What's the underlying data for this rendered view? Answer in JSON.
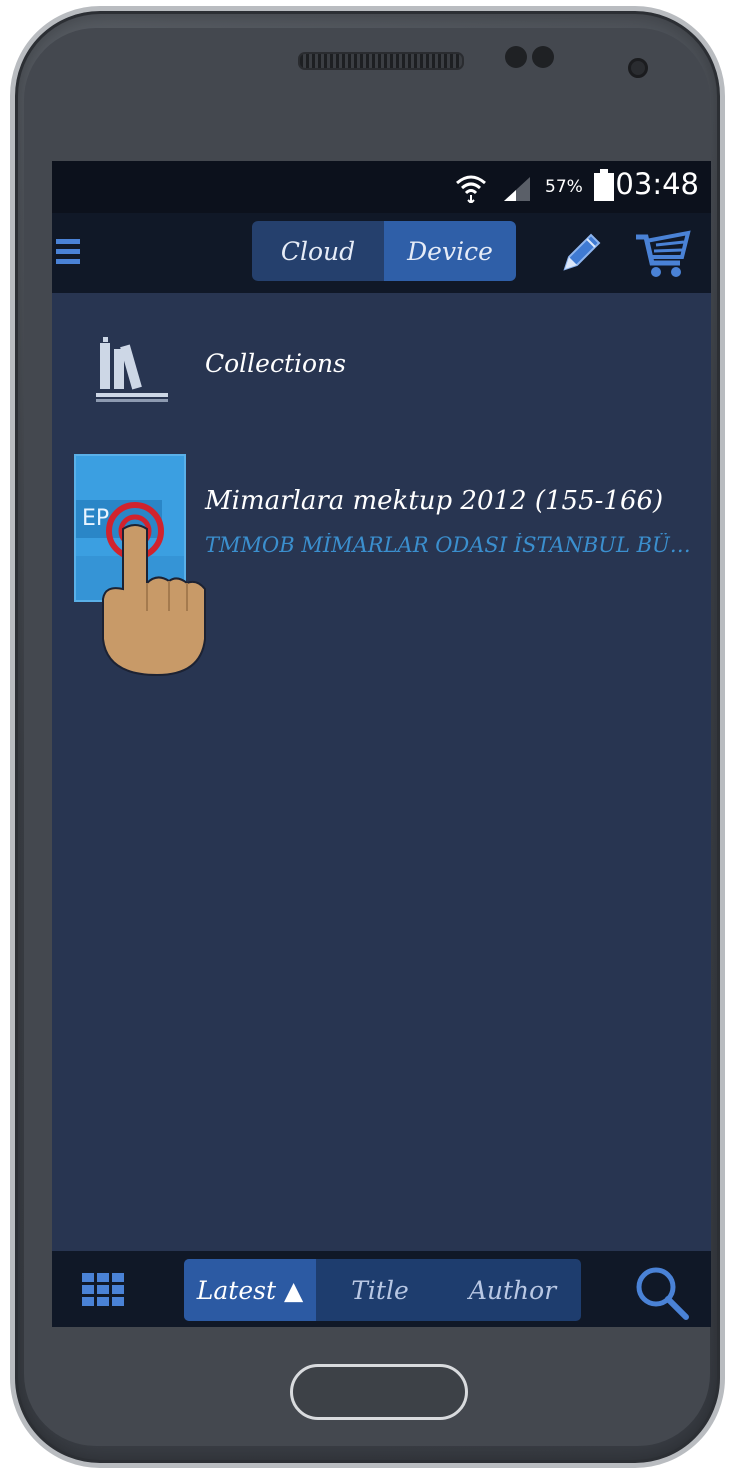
{
  "status_bar": {
    "battery_percent": "57%",
    "time": "03:48"
  },
  "top_bar": {
    "tabs": {
      "cloud": "Cloud",
      "device": "Device"
    },
    "active_tab": "Device"
  },
  "library": {
    "collections_label": "Collections",
    "book": {
      "cover_text": "EP",
      "title": "Mimarlara mektup 2012 (155-166)",
      "author": "TMMOB MİMARLAR ODASI İSTANBUL BÜY..."
    }
  },
  "bottom_bar": {
    "sort": {
      "latest": "Latest ▲",
      "title": "Title",
      "author": "Author"
    },
    "active_sort": "Latest"
  },
  "colors": {
    "screen_bg": "#283551",
    "accent": "#2f5fa8",
    "bar_bg": "#101827",
    "author_text": "#3b8fce"
  }
}
